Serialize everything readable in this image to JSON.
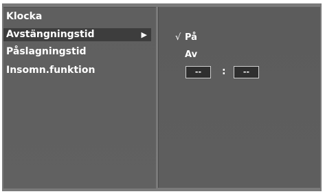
{
  "left_menu": {
    "items": [
      {
        "label": "Klocka"
      },
      {
        "label": "Avstängningstid",
        "submenu_indicator": "▶"
      },
      {
        "label": "Påslagningstid"
      },
      {
        "label": "Insomn.funktion"
      }
    ]
  },
  "right_panel": {
    "options": [
      {
        "label": "På",
        "check": "√"
      },
      {
        "label": "Av"
      }
    ],
    "time": {
      "hours": "--",
      "separator": ":",
      "minutes": "--"
    }
  }
}
